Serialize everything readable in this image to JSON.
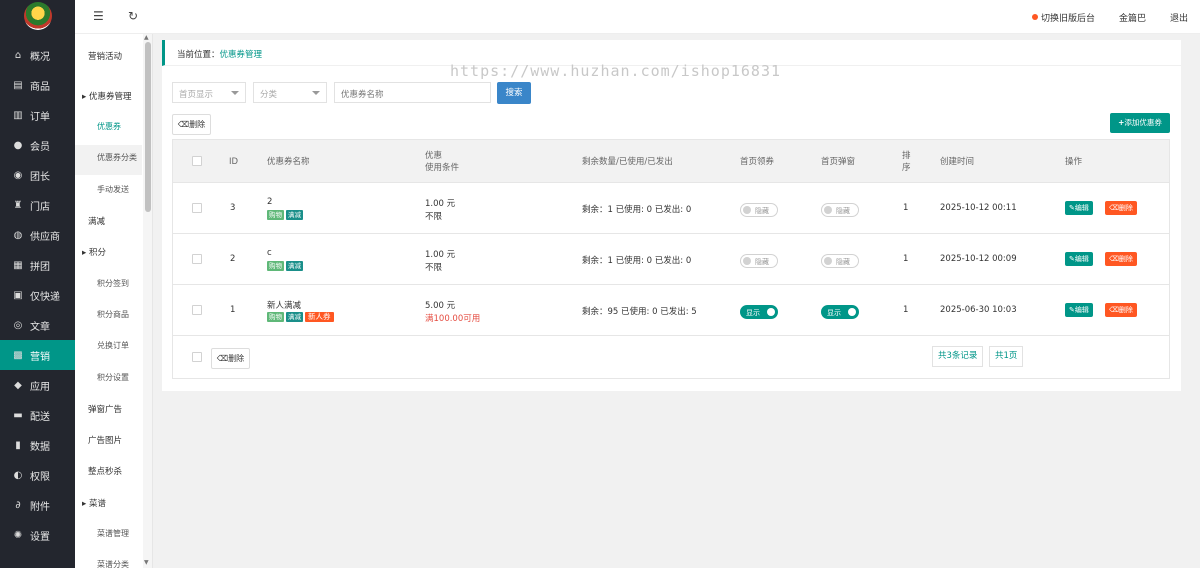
{
  "nav_main": {
    "items": [
      {
        "label": "概况",
        "icon": "home-icon",
        "glyph": "⌂"
      },
      {
        "label": "商品",
        "icon": "goods-icon",
        "glyph": "▤"
      },
      {
        "label": "订单",
        "icon": "order-icon",
        "glyph": "▥"
      },
      {
        "label": "会员",
        "icon": "member-icon",
        "glyph": "●"
      },
      {
        "label": "团长",
        "icon": "leader-icon",
        "glyph": "◉"
      },
      {
        "label": "门店",
        "icon": "store-icon",
        "glyph": "♜"
      },
      {
        "label": "供应商",
        "icon": "supplier-icon",
        "glyph": "◍"
      },
      {
        "label": "拼团",
        "icon": "group-icon",
        "glyph": "▦"
      },
      {
        "label": "仅快递",
        "icon": "express-icon",
        "glyph": "▣"
      },
      {
        "label": "文章",
        "icon": "article-icon",
        "glyph": "◎"
      },
      {
        "label": "营销",
        "icon": "marketing-icon",
        "glyph": "▩"
      },
      {
        "label": "应用",
        "icon": "app-icon",
        "glyph": "◆"
      },
      {
        "label": "配送",
        "icon": "delivery-icon",
        "glyph": "▬"
      },
      {
        "label": "数据",
        "icon": "data-icon",
        "glyph": "▮"
      },
      {
        "label": "权限",
        "icon": "permission-icon",
        "glyph": "◐"
      },
      {
        "label": "附件",
        "icon": "attachment-icon",
        "glyph": "∂"
      },
      {
        "label": "设置",
        "icon": "settings-icon",
        "glyph": "✺"
      }
    ],
    "active_index": 10,
    "active_color": "#009688"
  },
  "nav_sub": {
    "items": [
      {
        "label": "营销活动",
        "type": "top"
      },
      {
        "label": "▸ 优惠券管理",
        "type": "group"
      },
      {
        "label": "优惠券",
        "type": "child",
        "active": true
      },
      {
        "label": "优惠券分类",
        "type": "child"
      },
      {
        "label": "手动发送",
        "type": "child"
      },
      {
        "label": "满减",
        "type": "top"
      },
      {
        "label": "▸ 积分",
        "type": "group"
      },
      {
        "label": "积分签到",
        "type": "child"
      },
      {
        "label": "积分商品",
        "type": "child"
      },
      {
        "label": "兑换订单",
        "type": "child"
      },
      {
        "label": "积分设置",
        "type": "child"
      },
      {
        "label": "弹窗广告",
        "type": "top"
      },
      {
        "label": "广告图片",
        "type": "top"
      },
      {
        "label": "整点秒杀",
        "type": "top"
      },
      {
        "label": "▸ 菜谱",
        "type": "group"
      },
      {
        "label": "菜谱管理",
        "type": "child"
      },
      {
        "label": "菜谱分类",
        "type": "child"
      }
    ]
  },
  "header": {
    "menu_icon": "☰",
    "refresh_icon": "↻",
    "switch_label": "切换旧版后台",
    "user_name": "金篇巴",
    "logout_label": "退出"
  },
  "breadcrumb": {
    "prefix": "当前位置：",
    "current": "优惠券管理"
  },
  "watermark": "https://www.huzhan.com/ishop16831",
  "filters": {
    "homepage_display_placeholder": "首页显示",
    "category_placeholder": "分类",
    "name_placeholder": "优惠券名称",
    "search_label": "搜索"
  },
  "toolbar": {
    "delete_label": "删除",
    "add_label": "添加优惠券"
  },
  "table": {
    "headers": {
      "id": "ID",
      "name": "优惠券名称",
      "discount_line1": "优惠",
      "discount_line2": "使用条件",
      "quantity": "剩余数量/已使用/已发出",
      "home_receive": "首页领券",
      "home_popup": "首页弹窗",
      "sort_line1": "排",
      "sort_line2": "序",
      "created": "创建时间",
      "actions": "操作"
    },
    "rows": [
      {
        "id": "3",
        "name": "2",
        "tags": [
          "购物",
          "满减"
        ],
        "amount": "1.00 元",
        "condition": "不限",
        "qty": "剩余：1   已使用: 0   已发出: 0",
        "home_receive": "隐藏",
        "home_receive_on": false,
        "home_popup": "隐藏",
        "home_popup_on": false,
        "sort": "1",
        "created": "2025-10-12 00:11"
      },
      {
        "id": "2",
        "name": "c",
        "tags": [
          "购物",
          "满减"
        ],
        "amount": "1.00 元",
        "condition": "不限",
        "qty": "剩余：1   已使用: 0   已发出: 0",
        "home_receive": "隐藏",
        "home_receive_on": false,
        "home_popup": "隐藏",
        "home_popup_on": false,
        "sort": "1",
        "created": "2025-10-12 00:09"
      },
      {
        "id": "1",
        "name": "新人满减",
        "tags": [
          "购物",
          "满减",
          "新人券"
        ],
        "amount": "5.00 元",
        "condition": "满100.00可用",
        "qty": "剩余：95   已使用: 0   已发出: 5",
        "home_receive": "显示",
        "home_receive_on": true,
        "home_popup": "显示",
        "home_popup_on": true,
        "sort": "1",
        "created": "2025-06-30 10:03"
      }
    ],
    "edit_label": "编辑",
    "delete_label": "删除"
  },
  "footer": {
    "delete_label": "删除",
    "total_records": "共3条记录",
    "total_pages": "共1页"
  }
}
